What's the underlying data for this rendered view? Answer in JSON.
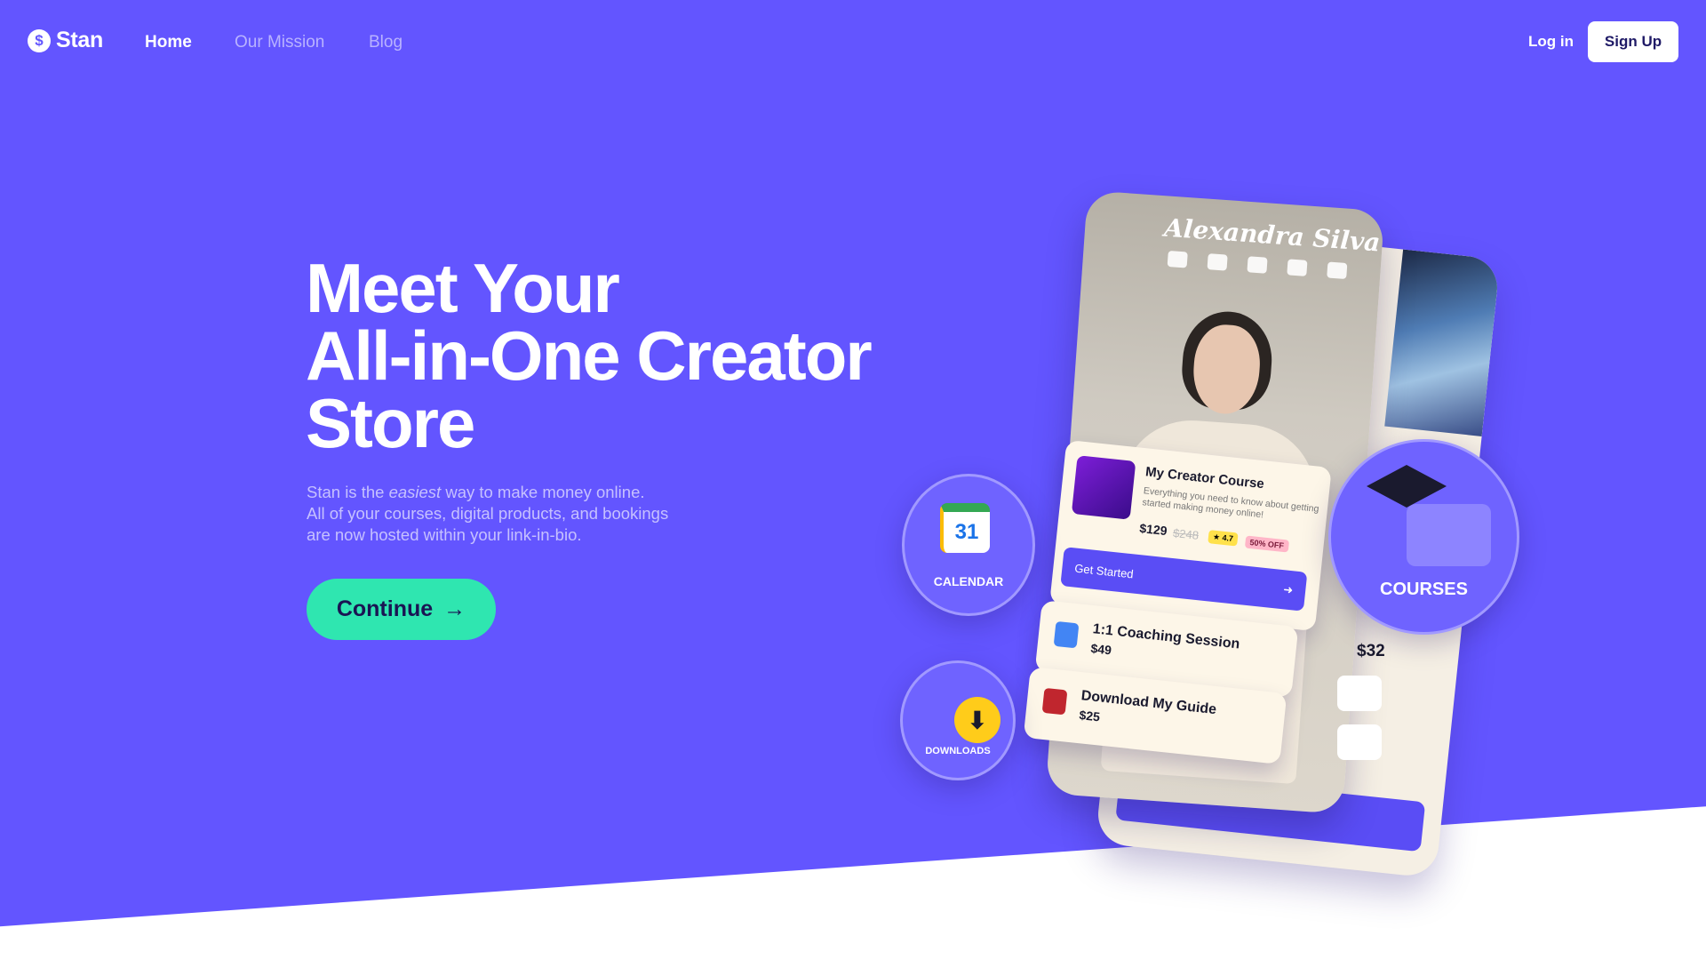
{
  "brand": {
    "name": "Stan",
    "logo_glyph": "$",
    "accent": "#6355FF",
    "cta_color": "#2FE6B0"
  },
  "nav": {
    "links": [
      {
        "label": "Home",
        "active": true
      },
      {
        "label": "Our Mission",
        "active": false
      },
      {
        "label": "Blog",
        "active": false
      }
    ],
    "login": "Log in",
    "signup": "Sign Up"
  },
  "hero": {
    "headline_lines": [
      "Meet Your",
      "All-in-One Creator",
      "Store"
    ],
    "sub_prefix": "Stan is the ",
    "sub_emphasis": "easiest",
    "sub_suffix": " way to make money online.",
    "sub_line2": "All of your courses, digital products, and bookings",
    "sub_line3": "are now hosted within your link-in-bio.",
    "cta": "Continue",
    "cta_arrow": "→"
  },
  "mockup": {
    "creator_name": "Alexandra Silva",
    "socials": [
      "youtube-icon",
      "tiktok-icon",
      "twitter-icon",
      "linkedin-icon",
      "instagram-icon"
    ],
    "course": {
      "title": "My Creator Course",
      "description": "Everything you need to know about getting started making money online!",
      "price": "$129",
      "old_price": "$248",
      "rating": "★ 4.7",
      "discount": "50% OFF",
      "button": "Get Started",
      "button_arrow": "➜"
    },
    "coaching": {
      "title": "1:1 Coaching Session",
      "price": "$49"
    },
    "guide": {
      "title": "Download My Guide",
      "price": "$25"
    },
    "side_price": "$32",
    "bubbles": {
      "calendar": "CALENDAR",
      "calendar_day": "31",
      "downloads": "DOWNLOADS",
      "downloads_glyph": "⬇",
      "courses": "COURSES"
    }
  }
}
